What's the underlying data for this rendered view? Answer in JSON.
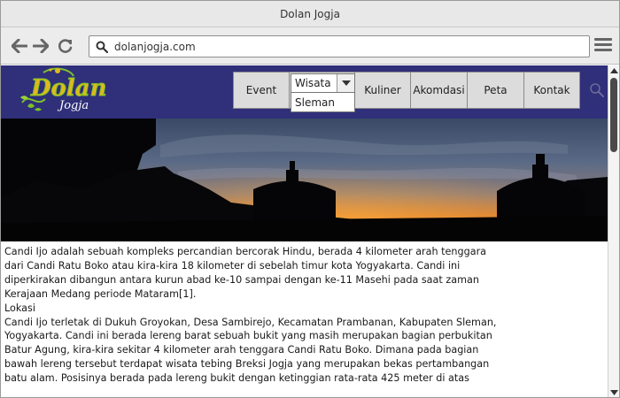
{
  "window": {
    "title": "Dolan Jogja"
  },
  "browser": {
    "address": "dolanjogja.com",
    "icons": [
      "back-arrow-icon",
      "forward-arrow-icon",
      "reload-icon",
      "search-icon",
      "hamburger-menu-icon"
    ]
  },
  "site": {
    "logo": {
      "main": "Dolan",
      "sub": "Jogja"
    },
    "nav": {
      "event": "Event",
      "wisata": {
        "selected": "Wisata",
        "option": "Sleman"
      },
      "kuliner": "Kuliner",
      "akomodasi": "Akomdasi",
      "peta": "Peta",
      "kontak": "Kontak"
    }
  },
  "article": {
    "paragraph1": "Candi Ijo adalah sebuah kompleks percandian bercorak Hindu, berada 4 kilometer arah tenggara dari Candi Ratu Boko atau kira-kira 18 kilometer di sebelah timur kota Yogyakarta. Candi ini diperkirakan dibangun antara kurun abad ke-10 sampai dengan ke-11 Masehi pada saat zaman Kerajaan Medang periode Mataram[1].",
    "heading": "Lokasi",
    "paragraph2": "Candi Ijo terletak di Dukuh Groyokan, Desa Sambirejo, Kecamatan Prambanan, Kabupaten Sleman, Yogyakarta. Candi ini berada lereng barat sebuah bukit yang masih merupakan bagian perbukitan Batur Agung, kira-kira sekitar 4 kilometer arah tenggara Candi Ratu Boko. Dimana pada bagian bawah lereng tersebut terdapat wisata tebing Breksi Jogja yang merupakan bekas pertambangan batu alam. Posisinya berada pada lereng bukit dengan ketinggian rata-rata 425 meter di atas"
  },
  "colors": {
    "header_bg": "#2f2f7a",
    "logo_green": "#7bc12a",
    "logo_gold": "#e0b91c",
    "sunset_orange": "#e06a1a"
  }
}
